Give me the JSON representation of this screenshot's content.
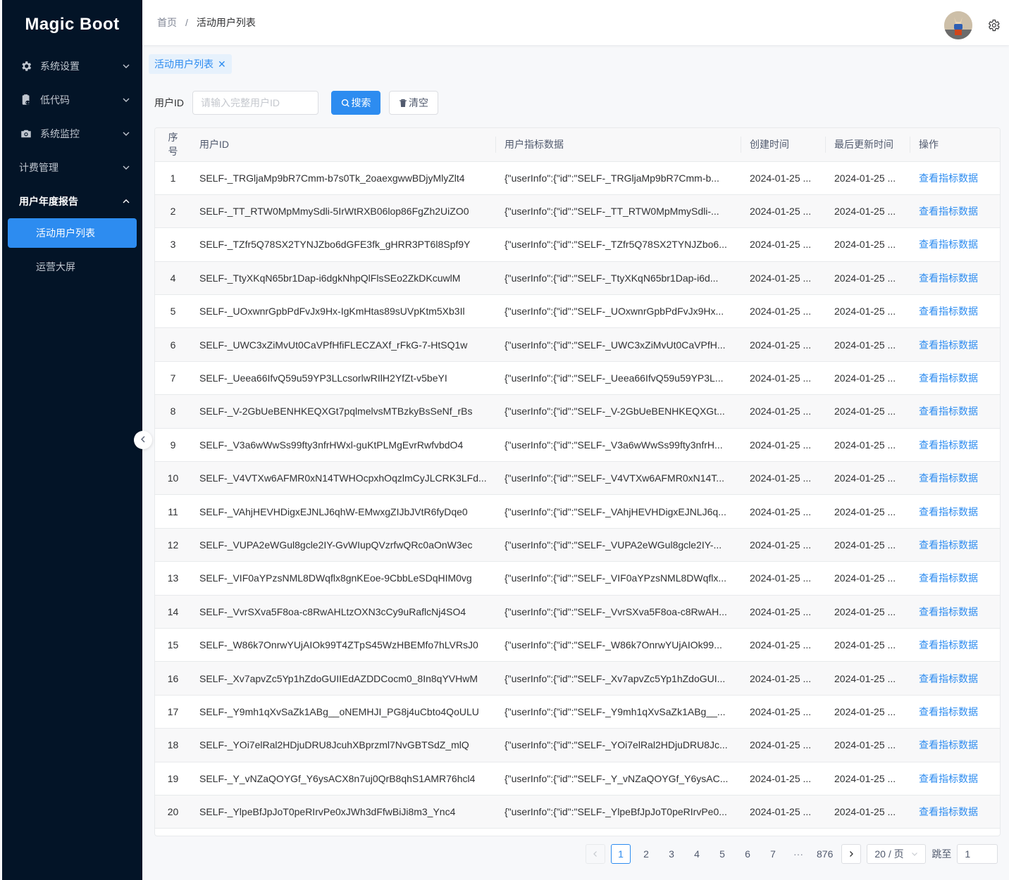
{
  "app": {
    "logo": "Magic Boot"
  },
  "sidebar": {
    "items": [
      {
        "label": "系统设置",
        "icon": "gear-icon",
        "expanded": false
      },
      {
        "label": "低代码",
        "icon": "code-file-icon",
        "expanded": false
      },
      {
        "label": "系统监控",
        "icon": "camera-icon",
        "expanded": false
      },
      {
        "label": "计费管理",
        "icon": "",
        "expanded": false
      },
      {
        "label": "用户年度报告",
        "icon": "",
        "expanded": true,
        "children": [
          {
            "label": "活动用户列表",
            "active": true
          },
          {
            "label": "运营大屏",
            "active": false
          }
        ]
      }
    ]
  },
  "header": {
    "breadcrumb": {
      "home": "首页",
      "separator": "/",
      "current": "活动用户列表"
    }
  },
  "tabs": [
    {
      "label": "活动用户列表",
      "closable": true
    }
  ],
  "search": {
    "label": "用户ID",
    "placeholder": "请输入完整用户ID",
    "value": "",
    "search_button": "搜索",
    "clear_button": "清空"
  },
  "table": {
    "columns": [
      "序号",
      "用户ID",
      "用户指标数据",
      "创建时间",
      "最后更新时间",
      "操作"
    ],
    "action_label": "查看指标数据",
    "rows": [
      {
        "idx": "1",
        "user_id": "SELF-_TRGljaMp9bR7Cmm-b7s0Tk_2oaexgwwBDjyMlyZlt4",
        "metrics": "{\"userInfo\":{\"id\":\"SELF-_TRGljaMp9bR7Cmm-b...",
        "created": "2024-01-25 ...",
        "updated": "2024-01-25 ..."
      },
      {
        "idx": "2",
        "user_id": "SELF-_TT_RTW0MpMmySdli-5IrWtRXB06lop86FgZh2UiZO0",
        "metrics": "{\"userInfo\":{\"id\":\"SELF-_TT_RTW0MpMmySdli-...",
        "created": "2024-01-25 ...",
        "updated": "2024-01-25 ..."
      },
      {
        "idx": "3",
        "user_id": "SELF-_TZfr5Q78SX2TYNJZbo6dGFE3fk_gHRR3PT6l8Spf9Y",
        "metrics": "{\"userInfo\":{\"id\":\"SELF-_TZfr5Q78SX2TYNJZbo6...",
        "created": "2024-01-25 ...",
        "updated": "2024-01-25 ..."
      },
      {
        "idx": "4",
        "user_id": "SELF-_TtyXKqN65br1Dap-i6dgkNhpQlFlsSEo2ZkDKcuwlM",
        "metrics": "{\"userInfo\":{\"id\":\"SELF-_TtyXKqN65br1Dap-i6d...",
        "created": "2024-01-25 ...",
        "updated": "2024-01-25 ..."
      },
      {
        "idx": "5",
        "user_id": "SELF-_UOxwnrGpbPdFvJx9Hx-IgKmHtas89sUVpKtm5Xb3Il",
        "metrics": "{\"userInfo\":{\"id\":\"SELF-_UOxwnrGpbPdFvJx9Hx...",
        "created": "2024-01-25 ...",
        "updated": "2024-01-25 ..."
      },
      {
        "idx": "6",
        "user_id": "SELF-_UWC3xZiMvUt0CaVPfHfiFLECZAXf_rFkG-7-HtSQ1w",
        "metrics": "{\"userInfo\":{\"id\":\"SELF-_UWC3xZiMvUt0CaVPfH...",
        "created": "2024-01-25 ...",
        "updated": "2024-01-25 ..."
      },
      {
        "idx": "7",
        "user_id": "SELF-_Ueea66IfvQ59u59YP3LLcsorlwRIlH2YfZt-v5beYI",
        "metrics": "{\"userInfo\":{\"id\":\"SELF-_Ueea66IfvQ59u59YP3L...",
        "created": "2024-01-25 ...",
        "updated": "2024-01-25 ..."
      },
      {
        "idx": "8",
        "user_id": "SELF-_V-2GbUeBENHKEQXGt7pqlmelvsMTBzkyBsSeNf_rBs",
        "metrics": "{\"userInfo\":{\"id\":\"SELF-_V-2GbUeBENHKEQXGt...",
        "created": "2024-01-25 ...",
        "updated": "2024-01-25 ..."
      },
      {
        "idx": "9",
        "user_id": "SELF-_V3a6wWwSs99fty3nfrHWxl-guKtPLMgEvrRwfvbdO4",
        "metrics": "{\"userInfo\":{\"id\":\"SELF-_V3a6wWwSs99fty3nfrH...",
        "created": "2024-01-25 ...",
        "updated": "2024-01-25 ..."
      },
      {
        "idx": "10",
        "user_id": "SELF-_V4VTXw6AFMR0xN14TWHOcpxhOqzlmCyJLCRK3LFd...",
        "metrics": "{\"userInfo\":{\"id\":\"SELF-_V4VTXw6AFMR0xN14T...",
        "created": "2024-01-25 ...",
        "updated": "2024-01-25 ..."
      },
      {
        "idx": "11",
        "user_id": "SELF-_VAhjHEVHDigxEJNLJ6qhW-EMwxgZIJbJVtR6fyDqe0",
        "metrics": "{\"userInfo\":{\"id\":\"SELF-_VAhjHEVHDigxEJNLJ6q...",
        "created": "2024-01-25 ...",
        "updated": "2024-01-25 ..."
      },
      {
        "idx": "12",
        "user_id": "SELF-_VUPA2eWGul8gcle2IY-GvWIupQVzrfwQRc0aOnW3ec",
        "metrics": "{\"userInfo\":{\"id\":\"SELF-_VUPA2eWGul8gcle2IY-...",
        "created": "2024-01-25 ...",
        "updated": "2024-01-25 ..."
      },
      {
        "idx": "13",
        "user_id": "SELF-_VIF0aYPzsNML8DWqflx8gnKEoe-9CbbLeSDqHIM0vg",
        "metrics": "{\"userInfo\":{\"id\":\"SELF-_VIF0aYPzsNML8DWqflx...",
        "created": "2024-01-25 ...",
        "updated": "2024-01-25 ..."
      },
      {
        "idx": "14",
        "user_id": "SELF-_VvrSXva5F8oa-c8RwAHLtzOXN3cCy9uRaflcNj4SO4",
        "metrics": "{\"userInfo\":{\"id\":\"SELF-_VvrSXva5F8oa-c8RwAH...",
        "created": "2024-01-25 ...",
        "updated": "2024-01-25 ..."
      },
      {
        "idx": "15",
        "user_id": "SELF-_W86k7OnrwYUjAIOk99T4ZTpS45WzHBEMfo7hLVRsJ0",
        "metrics": "{\"userInfo\":{\"id\":\"SELF-_W86k7OnrwYUjAIOk99...",
        "created": "2024-01-25 ...",
        "updated": "2024-01-25 ..."
      },
      {
        "idx": "16",
        "user_id": "SELF-_Xv7apvZc5Yp1hZdoGUIIEdAZDDCocm0_8In8qYVHwM",
        "metrics": "{\"userInfo\":{\"id\":\"SELF-_Xv7apvZc5Yp1hZdoGUI...",
        "created": "2024-01-25 ...",
        "updated": "2024-01-25 ..."
      },
      {
        "idx": "17",
        "user_id": "SELF-_Y9mh1qXvSaZk1ABg__oNEMHJI_PG8j4uCbto4QoULU",
        "metrics": "{\"userInfo\":{\"id\":\"SELF-_Y9mh1qXvSaZk1ABg__...",
        "created": "2024-01-25 ...",
        "updated": "2024-01-25 ..."
      },
      {
        "idx": "18",
        "user_id": "SELF-_YOi7elRal2HDjuDRU8JcuhXBprzml7NvGBTSdZ_mlQ",
        "metrics": "{\"userInfo\":{\"id\":\"SELF-_YOi7elRal2HDjuDRU8Jc...",
        "created": "2024-01-25 ...",
        "updated": "2024-01-25 ..."
      },
      {
        "idx": "19",
        "user_id": "SELF-_Y_vNZaQOYGf_Y6ysACX8n7uj0QrB8qhS1AMR76hcl4",
        "metrics": "{\"userInfo\":{\"id\":\"SELF-_Y_vNZaQOYGf_Y6ysAC...",
        "created": "2024-01-25 ...",
        "updated": "2024-01-25 ..."
      },
      {
        "idx": "20",
        "user_id": "SELF-_YlpeBfJpJoT0peRIrvPe0xJWh3dFfwBiJi8m3_Ync4",
        "metrics": "{\"userInfo\":{\"id\":\"SELF-_YlpeBfJpJoT0peRIrvPe0...",
        "created": "2024-01-25 ...",
        "updated": "2024-01-25 ..."
      }
    ]
  },
  "pagination": {
    "current": "1",
    "pages": [
      "1",
      "2",
      "3",
      "4",
      "5",
      "6",
      "7"
    ],
    "ellipsis": "···",
    "last": "876",
    "page_size": "20 / 页",
    "jump_label": "跳至",
    "jump_value": "1"
  },
  "colors": {
    "primary": "#2d8cf0",
    "sidebar_bg": "#031427"
  }
}
